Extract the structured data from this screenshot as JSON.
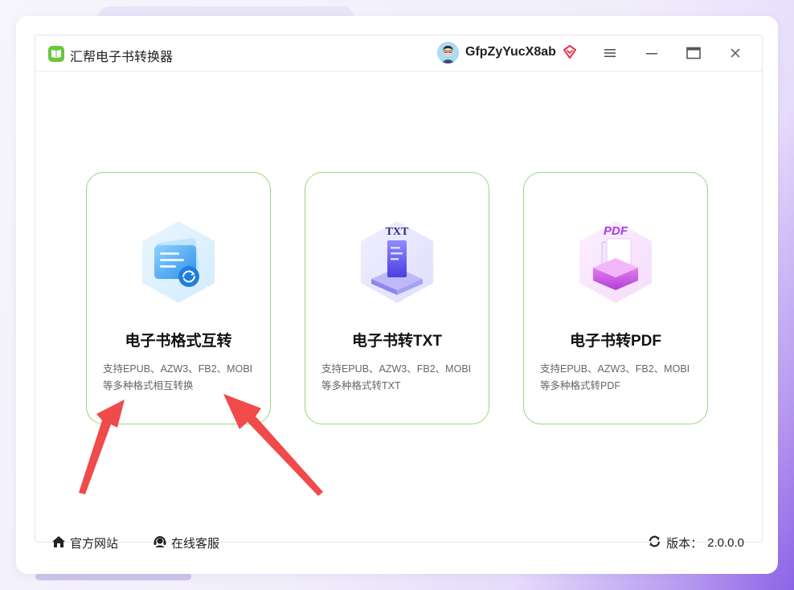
{
  "app": {
    "title": "汇帮电子书转换器"
  },
  "user": {
    "name": "GfpZyYucX8ab"
  },
  "cards": [
    {
      "title": "电子书格式互转",
      "desc_line1": "支持EPUB、AZW3、FB2、MOBI",
      "desc_line2": "等多种格式相互转换"
    },
    {
      "title": "电子书转TXT",
      "desc_line1": "支持EPUB、AZW3、FB2、MOBI",
      "desc_line2": "等多种格式转TXT",
      "badge": "TXT"
    },
    {
      "title": "电子书转PDF",
      "desc_line1": "支持EPUB、AZW3、FB2、MOBI",
      "desc_line2": "等多种格式转PDF",
      "badge": "PDF"
    }
  ],
  "footer": {
    "site": "官方网站",
    "service": "在线客服",
    "version_label": "版本：",
    "version": "2.0.0.0"
  },
  "colors": {
    "accent_green": "#68c83c",
    "card_border": "#9bd67a",
    "arrow_red": "#f04a4a",
    "vip_red": "#e8344a"
  },
  "icons": [
    "book-icon",
    "avatar-icon",
    "vip-diamond-icon",
    "hamburger-icon",
    "minimize-icon",
    "maximize-icon",
    "close-icon",
    "home-icon",
    "headset-icon",
    "refresh-icon"
  ]
}
